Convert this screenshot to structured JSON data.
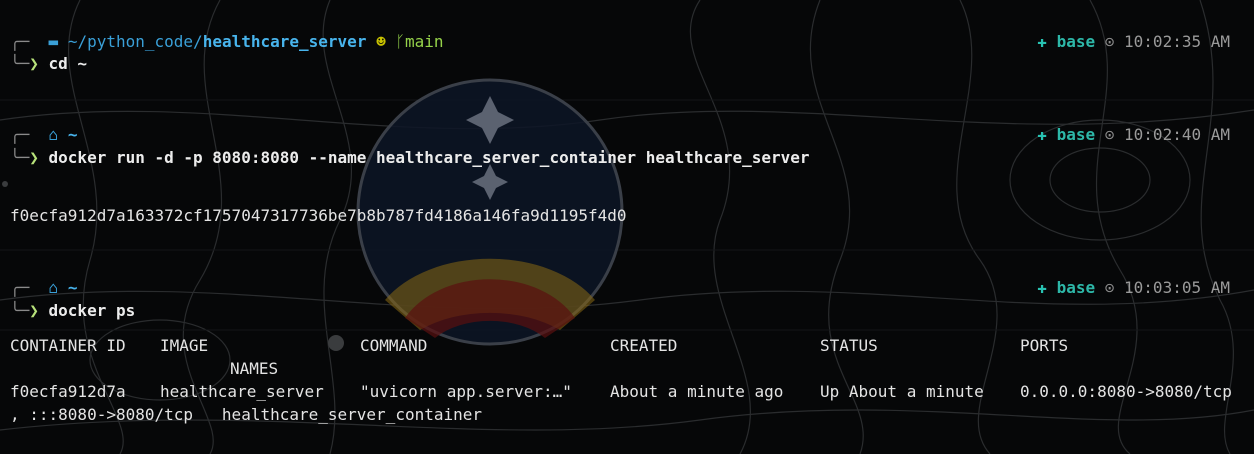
{
  "blocks": [
    {
      "path_dim": "~/python_code/",
      "path_bold": "healthcare_server",
      "git_branch": "main",
      "env": "base",
      "time": "10:02:35 AM",
      "command": "cd ~"
    },
    {
      "path_bold": "~",
      "env": "base",
      "time": "10:02:40 AM",
      "command": "docker run -d -p 8080:8080 --name healthcare_server_container healthcare_server",
      "output": "f0ecfa912d7a163372cf1757047317736be7b8b787fd4186a146fa9d1195f4d0"
    },
    {
      "path_bold": "~",
      "env": "base",
      "time": "10:03:05 AM",
      "command": "docker ps"
    }
  ],
  "docker_ps": {
    "headers": [
      "CONTAINER ID",
      "IMAGE",
      "COMMAND",
      "CREATED",
      "STATUS",
      "PORTS"
    ],
    "header_wrap": "NAMES",
    "row": [
      "f0ecfa912d7a",
      "healthcare_server",
      "\"uvicorn app.server:…\"",
      "About a minute ago",
      "Up About a minute",
      "0.0.0.0:8080->8080/tcp"
    ],
    "row_wrap": ", :::8080->8080/tcp   healthcare_server_container"
  },
  "icons": {
    "os": "apple-icon",
    "folder": "folder-icon",
    "home": "home-icon",
    "github": "github-icon",
    "branch": "git-branch-icon",
    "env": "python-env-icon",
    "clock": "clock-icon"
  },
  "colors": {
    "background": "#060708",
    "path": "#48b4ec",
    "branch": "#96d34a",
    "env": "#2db7a8",
    "prompt_chevron": "#b7e27a"
  }
}
